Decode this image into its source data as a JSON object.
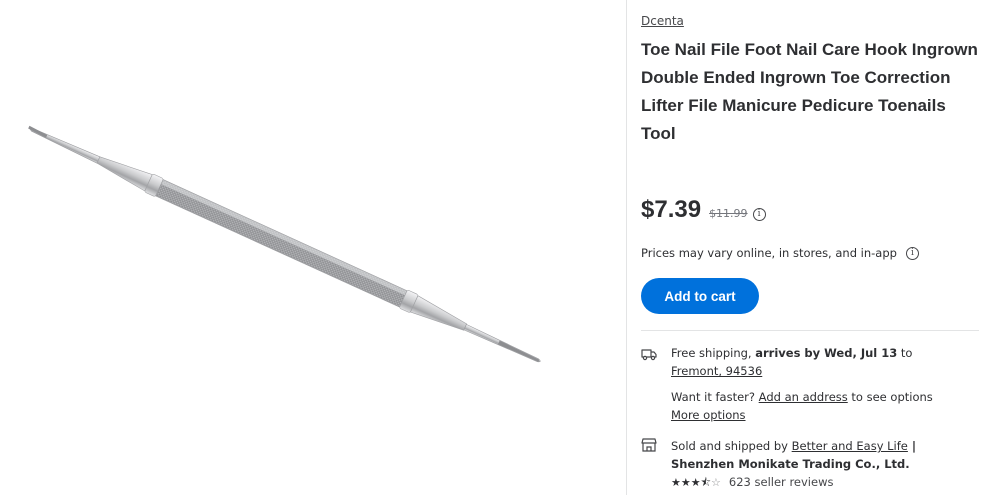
{
  "product": {
    "brand": "Dcenta",
    "title": "Toe Nail File Foot Nail Care Hook Ingrown Double Ended Ingrown Toe Correction Lifter File Manicure Pedicure Toenails Tool",
    "image_icon": "nail-file-tool-image"
  },
  "pricing": {
    "current_price": "$7.39",
    "was_price": "$11.99",
    "info_icon": "info-icon",
    "vary_note": "Prices may vary online, in stores, and in-app"
  },
  "actions": {
    "add_to_cart_label": "Add to cart",
    "accent_color": "#0071dc"
  },
  "shipping": {
    "icon": "truck-icon",
    "free_shipping": "Free shipping, ",
    "arrives": "arrives by Wed, Jul 13",
    "to": " to",
    "location": "Fremont, 94536",
    "want_faster": "Want it faster? ",
    "add_address": "Add an address",
    "see_options": " to see options",
    "more_options": "More options"
  },
  "seller": {
    "icon": "store-icon",
    "sold_by_prefix": "Sold and shipped by ",
    "seller_name": "Better and Easy Life",
    "seller_rest": " | Shenzhen Monikate Trading Co., Ltd.",
    "rating": 3.5,
    "reviews": "623 seller reviews"
  }
}
